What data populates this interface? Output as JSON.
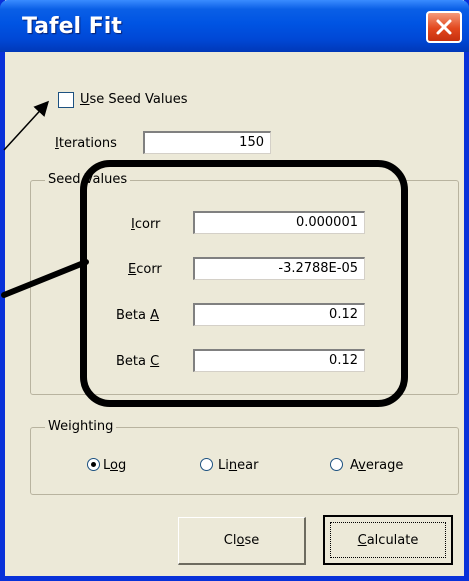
{
  "window": {
    "title": "Tafel Fit"
  },
  "use_seed": {
    "label_pre": "",
    "label_accel": "U",
    "label_post": "se Seed Values",
    "checked": false
  },
  "iterations": {
    "label_accel": "I",
    "label_post": "terations",
    "value": "150"
  },
  "seed_values": {
    "group_title": "Seed Values",
    "fields": [
      {
        "label_pre": "",
        "label_accel": "I",
        "label_post": "corr",
        "value": "0.000001"
      },
      {
        "label_pre": "",
        "label_accel": "E",
        "label_post": "corr",
        "value": "-3.2788E-05"
      },
      {
        "label_pre": "Beta ",
        "label_accel": "A",
        "label_post": "",
        "value": "0.12"
      },
      {
        "label_pre": "Beta ",
        "label_accel": "C",
        "label_post": "",
        "value": "0.12"
      }
    ]
  },
  "weighting": {
    "group_title": "Weighting",
    "options": [
      {
        "label_pre": "L",
        "label_accel": "o",
        "label_post": "g",
        "selected": true
      },
      {
        "label_pre": "Li",
        "label_accel": "n",
        "label_post": "ear",
        "selected": false
      },
      {
        "label_pre": "A",
        "label_accel": "v",
        "label_post": "erage",
        "selected": false
      }
    ]
  },
  "buttons": {
    "close": {
      "label_pre": "Cl",
      "label_accel": "o",
      "label_post": "se"
    },
    "calculate": {
      "label_pre": "",
      "label_accel": "C",
      "label_post": "alculate"
    }
  },
  "colors": {
    "title_bar": "#0054e3",
    "dialog_bg": "#ece9d8",
    "close_button": "#e2481e",
    "callout": "#000000"
  }
}
